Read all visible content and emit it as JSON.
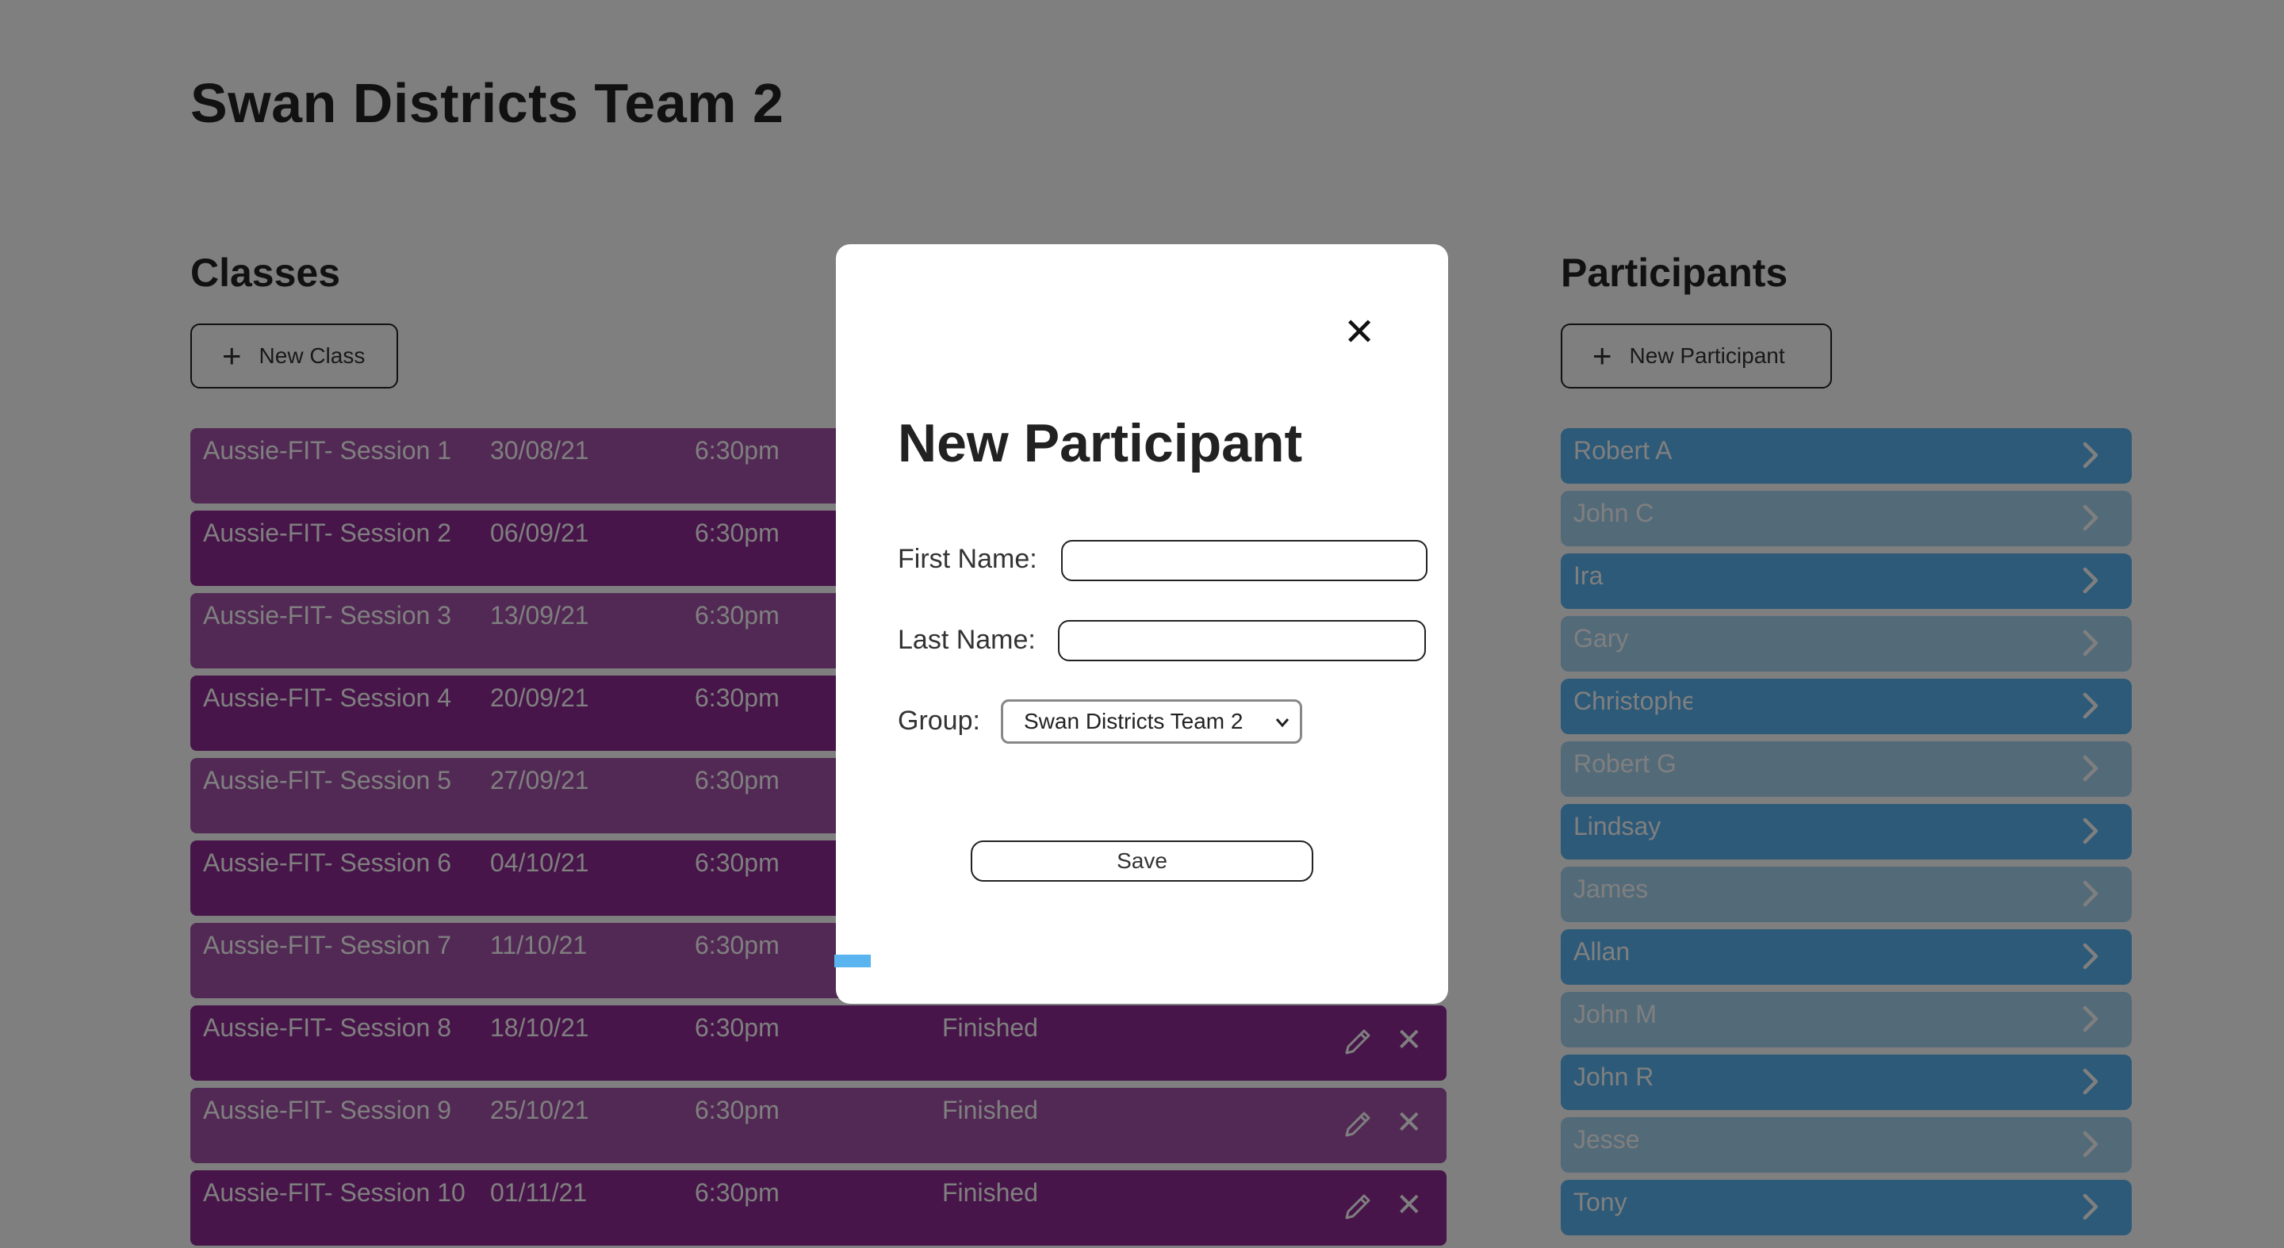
{
  "page": {
    "title": "Swan Districts Team 2"
  },
  "classes": {
    "title": "Classes",
    "new_button": "New Class",
    "rows": [
      {
        "name": "Aussie-FIT- Session 1",
        "date": "30/08/21",
        "time": "6:30pm",
        "status": ""
      },
      {
        "name": "Aussie-FIT- Session 2",
        "date": "06/09/21",
        "time": "6:30pm",
        "status": ""
      },
      {
        "name": "Aussie-FIT- Session 3",
        "date": "13/09/21",
        "time": "6:30pm",
        "status": ""
      },
      {
        "name": "Aussie-FIT- Session 4",
        "date": "20/09/21",
        "time": "6:30pm",
        "status": ""
      },
      {
        "name": "Aussie-FIT- Session 5",
        "date": "27/09/21",
        "time": "6:30pm",
        "status": ""
      },
      {
        "name": "Aussie-FIT- Session 6",
        "date": "04/10/21",
        "time": "6:30pm",
        "status": ""
      },
      {
        "name": "Aussie-FIT- Session 7",
        "date": "11/10/21",
        "time": "6:30pm",
        "status": ""
      },
      {
        "name": "Aussie-FIT- Session 8",
        "date": "18/10/21",
        "time": "6:30pm",
        "status": "Finished"
      },
      {
        "name": "Aussie-FIT- Session 9",
        "date": "25/10/21",
        "time": "6:30pm",
        "status": "Finished"
      },
      {
        "name": "Aussie-FIT- Session 10",
        "date": "01/11/21",
        "time": "6:30pm",
        "status": "Finished"
      }
    ]
  },
  "participants": {
    "title": "Participants",
    "new_button": "New Participant",
    "items": [
      "Robert A",
      "John C",
      "Ira",
      "Gary",
      "Christopher",
      "Robert G",
      "Lindsay",
      "James",
      "Allan",
      "John M",
      "John R",
      "Jesse",
      "Tony"
    ]
  },
  "modal": {
    "title": "New Participant",
    "close_icon": "close-icon",
    "first_name_label": "First Name:",
    "first_name_value": "",
    "last_name_label": "Last Name:",
    "last_name_value": "",
    "group_label": "Group:",
    "group_selected": "Swan Districts Team 2",
    "save_label": "Save"
  },
  "colors": {
    "class_row_light": "#a452a8",
    "class_row_dark": "#8e2a93",
    "participant_row_dark": "#5ab4f0",
    "participant_row_light": "#a6d4f2",
    "overlay": "rgba(0,0,0,0.5)"
  }
}
